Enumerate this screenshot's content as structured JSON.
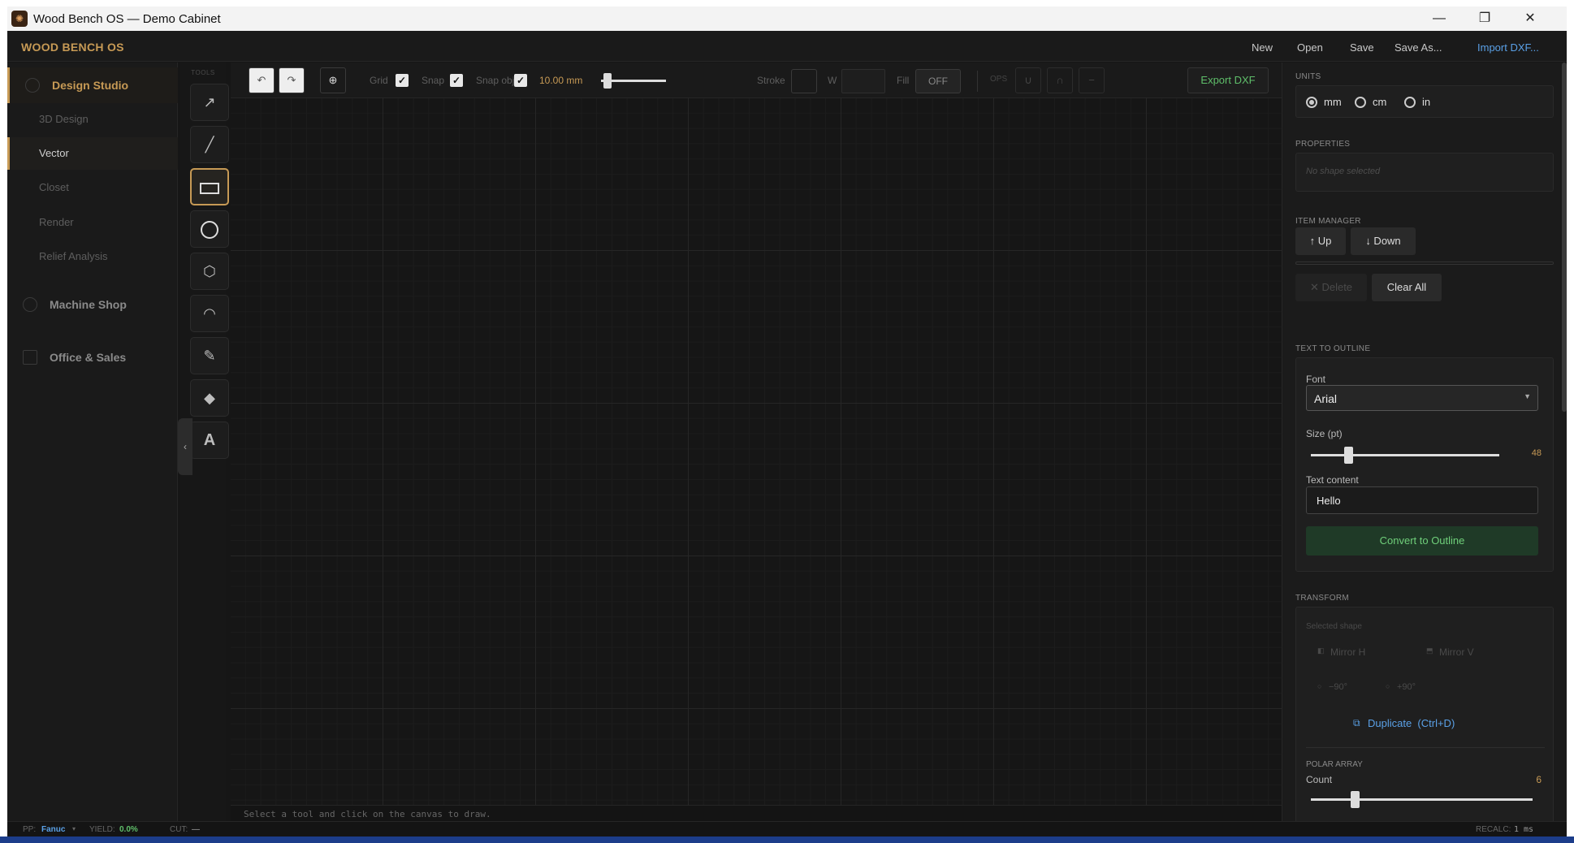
{
  "window": {
    "title": "Wood Bench OS — Demo Cabinet",
    "minimize": "—",
    "restore": "❐",
    "close": "✕",
    "app_icon": "app-logo-icon"
  },
  "appbar": {
    "brand": "WOOD BENCH OS",
    "menu": {
      "new": "New",
      "open": "Open",
      "save": "Save",
      "save_as": "Save As...",
      "import": "Import DXF..."
    }
  },
  "sidebar": {
    "design_studio": "Design Studio",
    "subitems": [
      "3D Design",
      "Vector",
      "Closet",
      "Render",
      "Relief Analysis"
    ],
    "active_subitem": "Vector",
    "machine_shop": "Machine Shop",
    "office_sales": "Office & Sales",
    "collapse": "‹"
  },
  "tools": {
    "label": "TOOLS",
    "items": [
      "select-arrow-icon",
      "line-icon",
      "rectangle-icon",
      "circle-icon",
      "polygon-icon",
      "arc-icon",
      "pencil-icon",
      "node-icon",
      "text-icon"
    ],
    "text_glyph": "A",
    "active": "rectangle-icon"
  },
  "toolbar": {
    "undo": "↶",
    "redo": "↷",
    "center": "⊕",
    "grid": "Grid",
    "snap": "Snap",
    "snap_obj": "Snap obj",
    "check": "✓",
    "grid_size": "10.00 mm",
    "grid_slider": 0.1,
    "stroke": "Stroke",
    "w": "W",
    "fill": "Fill",
    "fill_value": "OFF",
    "ops": "OPS",
    "op_union": "∪",
    "op_intersect": "∩",
    "op_subtract": "−",
    "export": "Export DXF"
  },
  "canvas": {
    "hint": "Select a tool and click on the canvas to draw."
  },
  "right_panel": {
    "units": {
      "title": "UNITS",
      "options": [
        "mm",
        "cm",
        "in"
      ],
      "selected": "mm"
    },
    "properties": {
      "title": "PROPERTIES",
      "empty": "No shape selected"
    },
    "item_manager": {
      "title": "ITEM MANAGER",
      "up": "↑ Up",
      "down": "↓ Down",
      "delete": "✕ Delete",
      "clear_all": "Clear All"
    },
    "text_to_outline": {
      "title": "TEXT TO OUTLINE",
      "font_label": "Font",
      "font_value": "Arial",
      "size_label": "Size (pt)",
      "size_value": "48",
      "size_slider": 0.2,
      "text_label": "Text content",
      "text_value": "Hello",
      "convert": "Convert to Outline"
    },
    "transform": {
      "title": "TRANSFORM",
      "selected_label": "Selected shape",
      "mirror_h": "Mirror H",
      "mirror_v": "Mirror V",
      "rot_neg": "−90°",
      "rot_pos": "+90°",
      "duplicate": "Duplicate  (Ctrl+D)"
    },
    "polar_array": {
      "title": "POLAR ARRAY",
      "count_label": "Count",
      "count_value": "6",
      "count_slider": 0.2
    }
  },
  "status": {
    "pp_label": "PP:",
    "pp_value": "Fanuc",
    "yield_label": "YIELD:",
    "yield_value": "0.0%",
    "cut_label": "CUT:",
    "cut_value": "—",
    "recalc_label": "RECALC:",
    "recalc_value": "1 ms"
  },
  "colors": {
    "accent": "#c79a55",
    "link": "#5aa0e6",
    "green": "#5fbf6a",
    "canvas": "#161616"
  }
}
